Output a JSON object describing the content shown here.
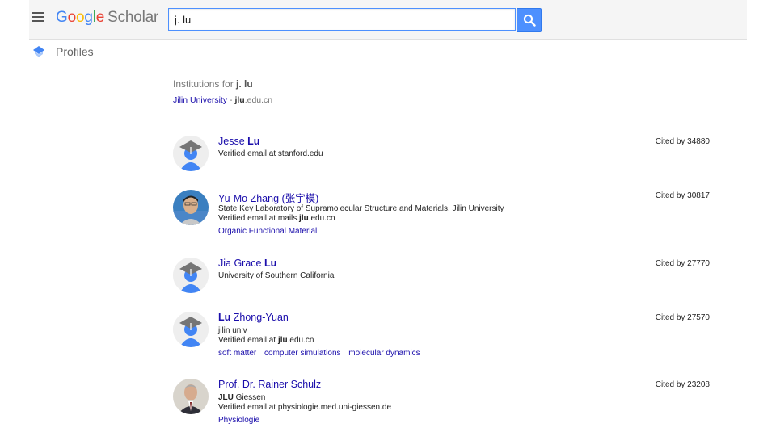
{
  "header": {
    "logo_google": "Google",
    "logo_scholar": "Scholar",
    "search_value": "j. lu"
  },
  "subbar": {
    "label": "Profiles"
  },
  "institutions": {
    "prefix": "Institutions for ",
    "query": "j. lu",
    "university": "Jilin University",
    "separator": " - ",
    "domain_bold": "jlu",
    "domain_rest": ".edu.cn"
  },
  "people": [
    {
      "name_pre": "Jesse ",
      "name_bold": "Lu",
      "name_post": "",
      "affil": "",
      "email_pre": "Verified email at stanford.edu",
      "email_bold": "",
      "email_post": "",
      "tags": [],
      "cited": "Cited by 34880",
      "avatar": "default"
    },
    {
      "name_pre": "Yu-Mo Zhang (张宇模)",
      "name_bold": "",
      "name_post": "",
      "affil": "State Key Laboratory of Supramolecular Structure and Materials, Jilin University",
      "email_pre": "Verified email at mails.",
      "email_bold": "jlu",
      "email_post": ".edu.cn",
      "tags": [
        "Organic Functional Material"
      ],
      "cited": "Cited by 30817",
      "avatar": "photo-young"
    },
    {
      "name_pre": "Jia Grace ",
      "name_bold": "Lu",
      "name_post": "",
      "affil": "University of Southern California",
      "email_pre": "",
      "email_bold": "",
      "email_post": "",
      "tags": [],
      "cited": "Cited by 27770",
      "avatar": "default"
    },
    {
      "name_pre": "",
      "name_bold": "Lu",
      "name_post": " Zhong-Yuan",
      "affil": "jilin univ",
      "email_pre": "Verified email at ",
      "email_bold": "jlu",
      "email_post": ".edu.cn",
      "tags": [
        "soft matter",
        "computer simulations",
        "molecular dynamics"
      ],
      "cited": "Cited by 27570",
      "avatar": "default"
    },
    {
      "name_pre": "Prof. Dr. Rainer Schulz",
      "name_bold": "",
      "name_post": "",
      "affil_bold": "JLU",
      "affil": " Giessen",
      "email_pre": "Verified email at physiologie.med.uni-giessen.de",
      "email_bold": "",
      "email_post": "",
      "tags": [
        "Physiologie"
      ],
      "cited": "Cited by 23208",
      "avatar": "photo-suit"
    }
  ]
}
